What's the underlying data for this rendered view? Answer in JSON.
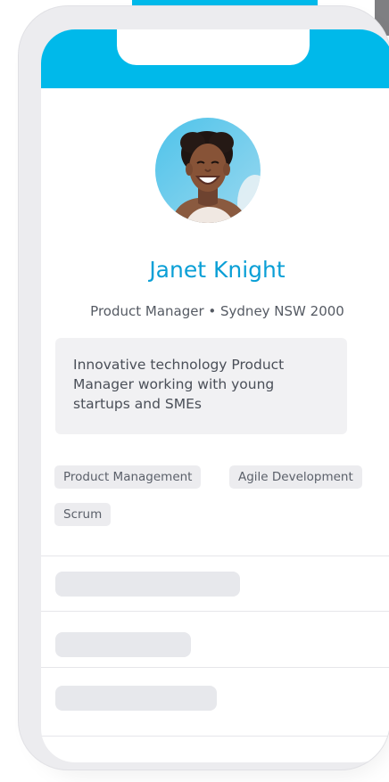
{
  "theme": {
    "accent": "#00b9ea",
    "name_color": "#0a9fd6",
    "tag_bg": "#ececef",
    "placeholder_bg": "#e7e8ec"
  },
  "profile": {
    "name": "Janet Knight",
    "subtitle": "Product Manager • Sydney NSW 2000",
    "bio": "Innovative technology Product Manager working with young startups and SMEs",
    "avatar_icon": "avatar-photo"
  },
  "tags": [
    {
      "label": "Product Management"
    },
    {
      "label": "Agile Development"
    },
    {
      "label": "Scrum"
    }
  ],
  "placeholders": [
    {
      "fill": 0.56
    },
    {
      "fill": 0.41
    },
    {
      "fill": 0.49
    }
  ]
}
